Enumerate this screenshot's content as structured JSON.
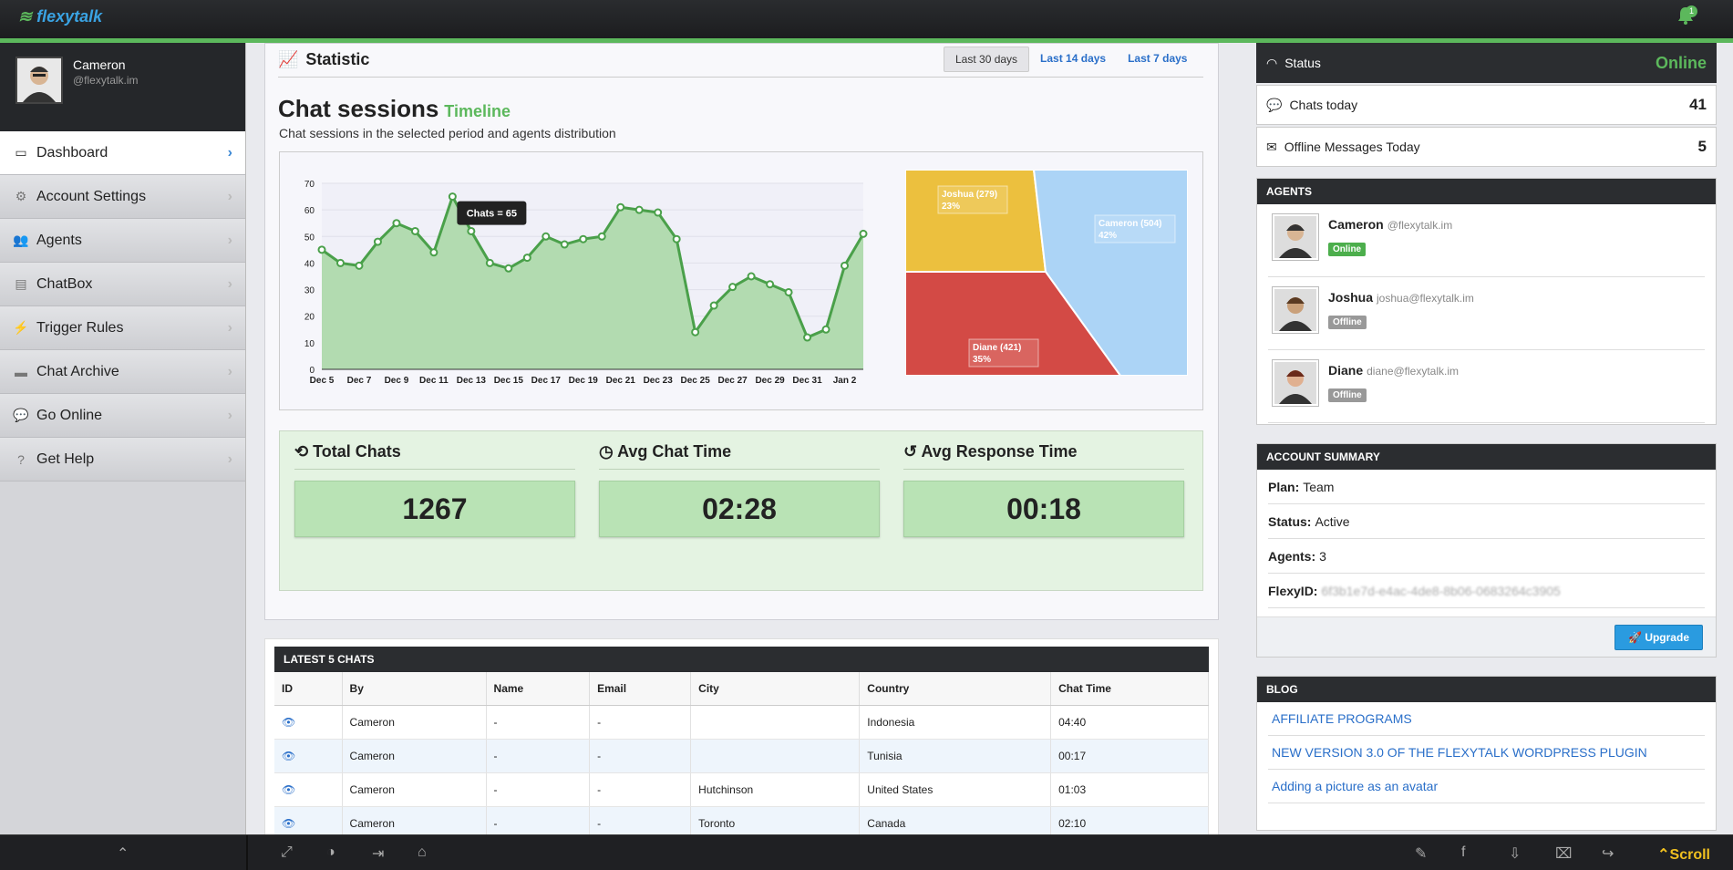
{
  "app": {
    "logo_text": "flexytalk",
    "notification_count": "1"
  },
  "profile": {
    "name": "Cameron",
    "email": "@flexytalk.im"
  },
  "nav": [
    {
      "label": "Dashboard",
      "icon": "monitor-icon",
      "glyph": "▭",
      "active": true
    },
    {
      "label": "Account Settings",
      "icon": "gears-icon",
      "glyph": "⚙"
    },
    {
      "label": "Agents",
      "icon": "users-icon",
      "glyph": "👥"
    },
    {
      "label": "ChatBox",
      "icon": "document-icon",
      "glyph": "▤"
    },
    {
      "label": "Trigger Rules",
      "icon": "bolt-icon",
      "glyph": "⚡"
    },
    {
      "label": "Chat Archive",
      "icon": "archive-icon",
      "glyph": "▬"
    },
    {
      "label": "Go Online",
      "icon": "chat-icon",
      "glyph": "💬"
    },
    {
      "label": "Get Help",
      "icon": "help-icon",
      "glyph": "?"
    }
  ],
  "statistic": {
    "title": "Statistic",
    "tabs": [
      "Last 30 days",
      "Last 14 days",
      "Last 7 days"
    ],
    "active_tab": 0,
    "heading": "Chat sessions",
    "heading_tag": "Timeline",
    "subtitle": "Chat sessions in the selected period and agents distribution"
  },
  "chart_data": [
    {
      "type": "area",
      "categories": [
        "Dec 5",
        "Dec 6",
        "Dec 7",
        "Dec 8",
        "Dec 9",
        "Dec 10",
        "Dec 11",
        "Dec 12",
        "Dec 13",
        "Dec 14",
        "Dec 15",
        "Dec 16",
        "Dec 17",
        "Dec 18",
        "Dec 19",
        "Dec 20",
        "Dec 21",
        "Dec 22",
        "Dec 23",
        "Dec 24",
        "Dec 25",
        "Dec 26",
        "Dec 27",
        "Dec 28",
        "Dec 29",
        "Dec 30",
        "Dec 31",
        "Jan 1",
        "Jan 2",
        "Jan 3"
      ],
      "tick_labels": [
        "Dec 5",
        "Dec 7",
        "Dec 9",
        "Dec 11",
        "Dec 13",
        "Dec 15",
        "Dec 17",
        "Dec 19",
        "Dec 21",
        "Dec 23",
        "Dec 25",
        "Dec 27",
        "Dec 29",
        "Dec 31",
        "Jan 2"
      ],
      "values": [
        45,
        40,
        39,
        48,
        55,
        52,
        44,
        65,
        52,
        40,
        38,
        42,
        50,
        47,
        49,
        50,
        61,
        60,
        59,
        49,
        14,
        24,
        31,
        35,
        32,
        29,
        12,
        15,
        39,
        51
      ],
      "ylim": [
        0,
        70
      ],
      "yticks": [
        0,
        10,
        20,
        30,
        40,
        50,
        60,
        70
      ],
      "tooltip": "Chats = 65",
      "tooltip_index": 7,
      "colors": {
        "line": "#4aa04a",
        "fill": "#b2dbb0"
      }
    },
    {
      "type": "pie",
      "slices": [
        {
          "label": "Joshua (279)",
          "percent": "23%",
          "value": 279,
          "color": "#ecc03e"
        },
        {
          "label": "Cameron (504)",
          "percent": "42%",
          "value": 504,
          "color": "#acd4f6"
        },
        {
          "label": "Diane (421)",
          "percent": "35%",
          "value": 421,
          "color": "#d34a45"
        }
      ]
    }
  ],
  "metrics": [
    {
      "title": "Total Chats",
      "icon": "chats-icon",
      "glyph": "⟲",
      "value": "1267"
    },
    {
      "title": "Avg Chat Time",
      "icon": "clock-icon",
      "glyph": "◷",
      "value": "02:28"
    },
    {
      "title": "Avg Response Time",
      "icon": "history-icon",
      "glyph": "↺",
      "value": "00:18"
    }
  ],
  "latest": {
    "header": "LATEST 5 CHATS",
    "columns": [
      "ID",
      "By",
      "Name",
      "Email",
      "City",
      "Country",
      "Chat Time"
    ],
    "rows": [
      [
        "",
        "Cameron",
        "-",
        "-",
        "",
        "Indonesia",
        "04:40"
      ],
      [
        "",
        "Cameron",
        "-",
        "-",
        "",
        "Tunisia",
        "00:17"
      ],
      [
        "",
        "Cameron",
        "-",
        "-",
        "Hutchinson",
        "United States",
        "01:03"
      ],
      [
        "",
        "Cameron",
        "-",
        "-",
        "Toronto",
        "Canada",
        "02:10"
      ]
    ]
  },
  "status": {
    "label": "Status",
    "value": "Online"
  },
  "counters": [
    {
      "label": "Chats today",
      "value": "41",
      "icon": "chat-icon"
    },
    {
      "label": "Offline Messages Today",
      "value": "5",
      "icon": "envelope-icon"
    }
  ],
  "agents": {
    "header": "AGENTS",
    "list": [
      {
        "name": "Cameron",
        "email": "@flexytalk.im",
        "status": "Online",
        "color": "#4cae4c"
      },
      {
        "name": "Joshua",
        "email": "joshua@flexytalk.im",
        "status": "Offline",
        "color": "#999999"
      },
      {
        "name": "Diane",
        "email": "diane@flexytalk.im",
        "status": "Offline",
        "color": "#999999"
      }
    ]
  },
  "account": {
    "header": "ACCOUNT SUMMARY",
    "rows": [
      {
        "k": "Plan:",
        "v": "Team"
      },
      {
        "k": "Status:",
        "v": "Active"
      },
      {
        "k": "Agents:",
        "v": "3"
      },
      {
        "k": "FlexyID:",
        "v": "6f3b1e7d-e4ac-4de8-8b06-0683264c3905"
      }
    ],
    "upgrade": "Upgrade"
  },
  "blog": {
    "header": "BLOG",
    "links": [
      "AFFILIATE PROGRAMS",
      "NEW VERSION 3.0 OF THE FLEXYTALK WORDPRESS PLUGIN",
      "Adding a picture as an avatar"
    ]
  },
  "footer": {
    "scroll": "Scroll"
  }
}
